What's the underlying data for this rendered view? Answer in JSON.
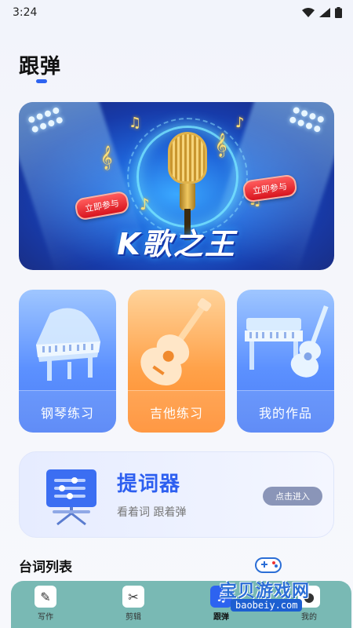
{
  "status_bar": {
    "time": "3:24"
  },
  "page": {
    "title": "跟弹"
  },
  "banner": {
    "title": "K歌之王",
    "tag_left": "立即参与",
    "tag_right": "立即参与"
  },
  "cards": [
    {
      "label": "钢琴练习"
    },
    {
      "label": "吉他练习"
    },
    {
      "label": "我的作品"
    }
  ],
  "teleprompter": {
    "title": "提词器",
    "subtitle": "看着词 跟着弹",
    "button": "点击进入"
  },
  "section": {
    "title": "台词列表"
  },
  "tabbar": {
    "items": [
      {
        "label": "写作",
        "icon": "pen-icon"
      },
      {
        "label": "剪辑",
        "icon": "scissors-icon"
      },
      {
        "label": "跟弹",
        "icon": "piano-icon",
        "active": true
      },
      {
        "label": "我的",
        "icon": "user-icon"
      }
    ]
  },
  "watermark": {
    "text": "宝贝游戏网",
    "url": "baobeiy.com"
  },
  "colors": {
    "accent": "#2d63f0",
    "tabbar": "#79b9b4",
    "card_blue": "#5c91ff",
    "card_orange": "#ffa24a"
  }
}
